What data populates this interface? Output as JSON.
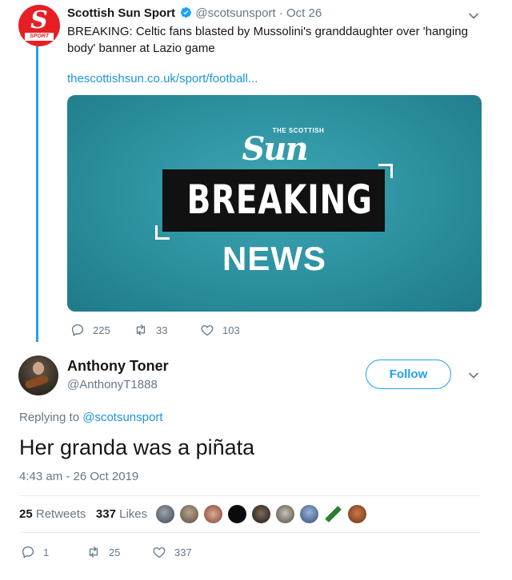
{
  "parent_tweet": {
    "avatar_icon": "scottish-sun-sport-logo",
    "avatar_letter": "S",
    "avatar_caption": "SPORT",
    "display_name": "Scottish Sun Sport",
    "handle": "@scotsunsport",
    "separator": "·",
    "date": "Oct 26",
    "text": "BREAKING: Celtic fans blasted by Mussolini's granddaughter over 'hanging body' banner at Lazio game",
    "link": "thescottishsun.co.uk/sport/football...",
    "card": {
      "logo_small": "THE SCOTTISH",
      "logo_big": "Sun",
      "breaking": "BREAKING",
      "news": "NEWS"
    },
    "actions": {
      "replies": "225",
      "retweets": "33",
      "likes": "103"
    }
  },
  "reply_tweet": {
    "display_name": "Anthony Toner",
    "handle": "@AnthonyT1888",
    "follow_label": "Follow",
    "replying_prefix": "Replying to",
    "replying_to": "@scotsunsport",
    "text": "Her granda was a piñata",
    "timestamp": "4:43 am - 26 Oct 2019",
    "retweet_count": "25",
    "retweet_label": "Retweets",
    "like_count": "337",
    "like_label": "Likes",
    "actions": {
      "replies": "1",
      "retweets": "25",
      "likes": "337"
    }
  },
  "colors": {
    "accent": "#1da1f2",
    "link": "#1b95e0",
    "muted": "#657786",
    "card_teal": "#2b8f9e",
    "sun_red": "#e81e25"
  }
}
